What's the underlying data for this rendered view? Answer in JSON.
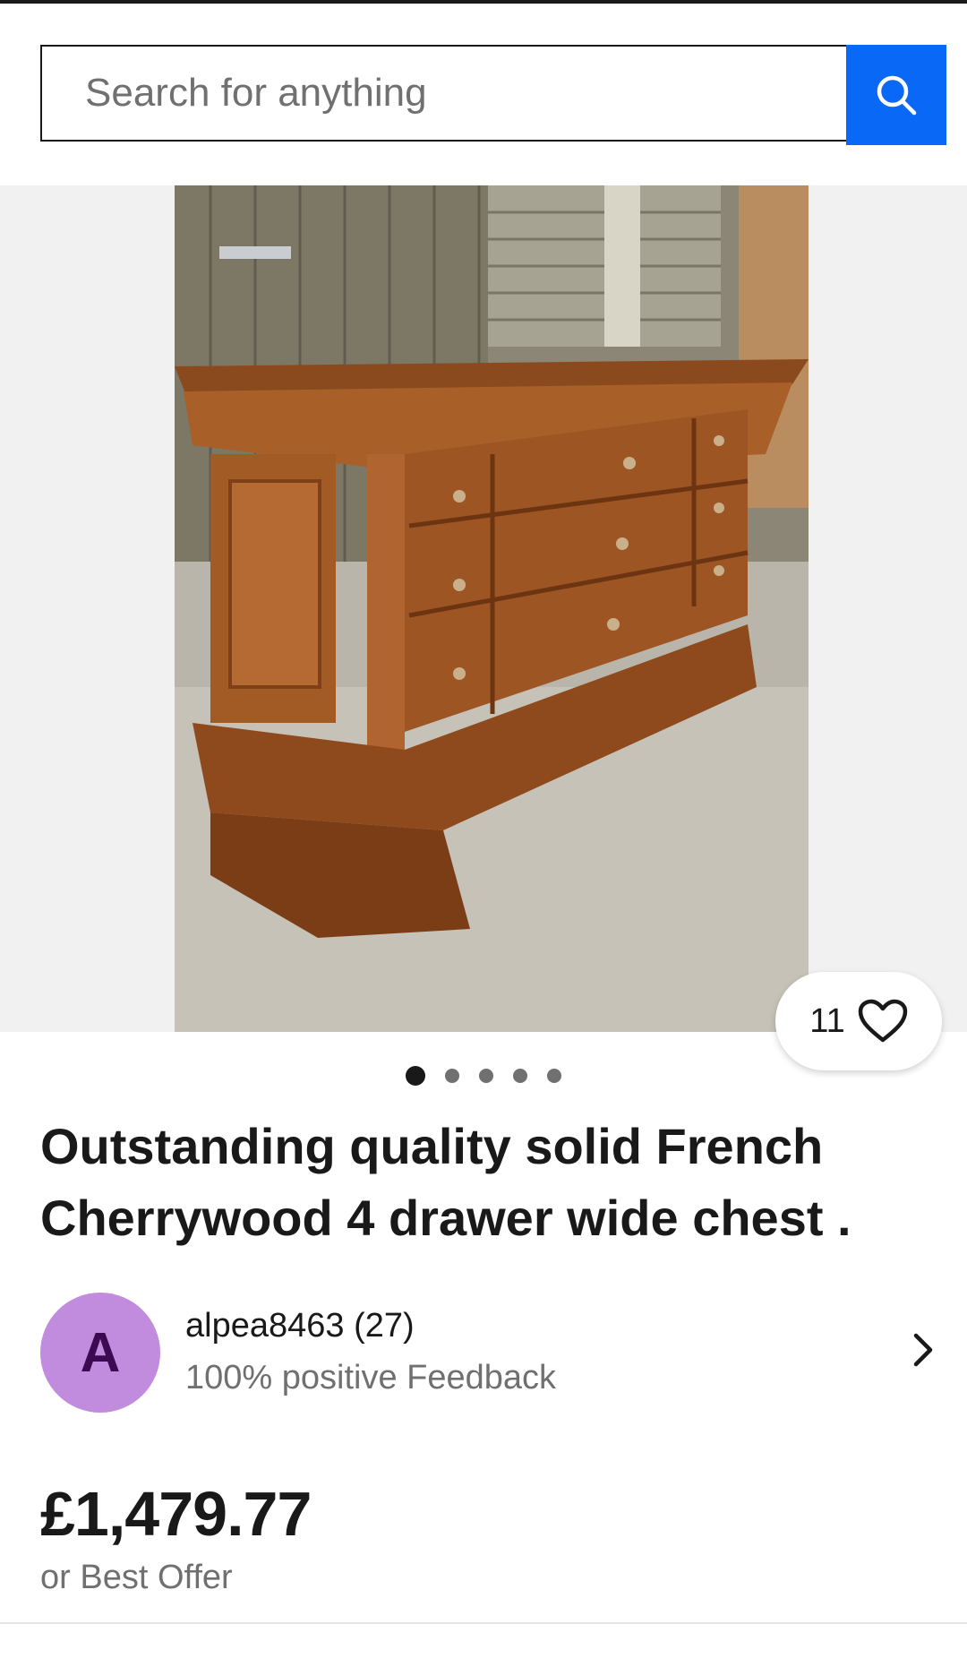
{
  "search": {
    "placeholder": "Search for anything",
    "button_icon": "search-icon"
  },
  "gallery": {
    "image_alt": "Outstanding quality solid French Cherrywood 4 drawer wide chest .",
    "watchers_count": "11",
    "watch_icon": "heart-outline-icon",
    "total_images": 5,
    "active_image_index": 0
  },
  "listing": {
    "title": "Outstanding quality solid French Cherrywood 4 drawer wide chest ."
  },
  "seller": {
    "avatar_letter": "A",
    "name": "alpea8463 (27)",
    "feedback": "100% positive Feedback",
    "chevron_icon": "chevron-right-icon"
  },
  "pricing": {
    "price": "£1,479.77",
    "offer_text": "or Best Offer"
  },
  "colors": {
    "accent_blue": "#0968f6",
    "avatar_bg": "#c18bde",
    "text_primary": "#191919",
    "text_secondary": "#707070"
  }
}
